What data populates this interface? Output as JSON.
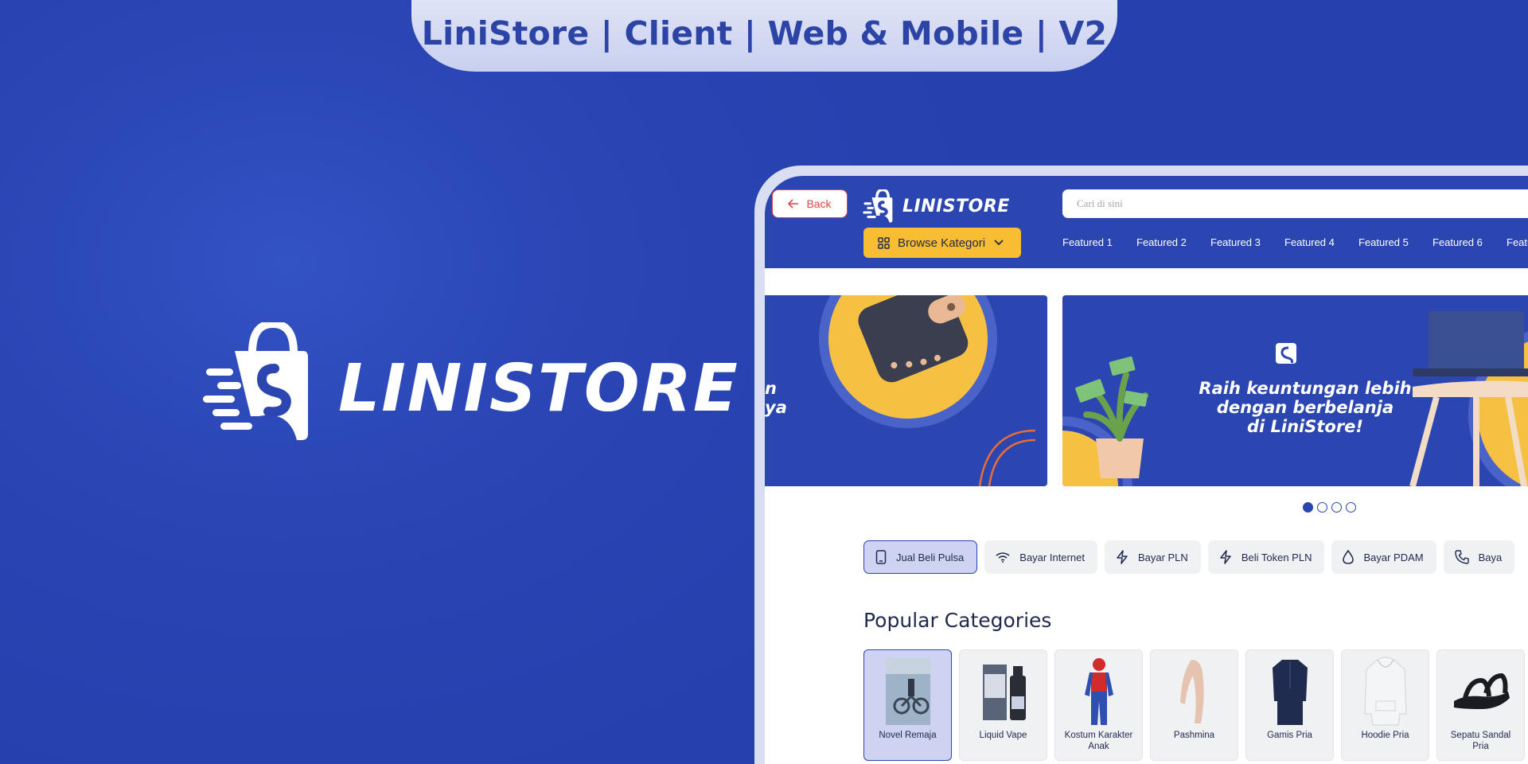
{
  "title_pill": "LiniStore | Client | Web & Mobile | V2",
  "brand": {
    "wordmark": "LINISTORE"
  },
  "site": {
    "back_label": "Back",
    "logo_wordmark": "LINISTORE",
    "search_placeholder": "Cari di sini",
    "browse_label": "Browse Kategori",
    "featured": [
      "Featured 1",
      "Featured 2",
      "Featured 3",
      "Featured 4",
      "Featured 5",
      "Featured 6",
      "Featu"
    ]
  },
  "banners": {
    "left_cut_text": [
      "n",
      "ya"
    ],
    "right_text": [
      "Raih keuntungan lebih",
      "dengan berbelanja",
      "di LiniStore!"
    ],
    "active_slide": 1,
    "slide_count": 4
  },
  "services": [
    {
      "label": "Jual Beli Pulsa",
      "icon": "phone-icon",
      "active": true
    },
    {
      "label": "Bayar Internet",
      "icon": "wifi-icon",
      "active": false
    },
    {
      "label": "Bayar PLN",
      "icon": "lightning-icon",
      "active": false
    },
    {
      "label": "Beli Token PLN",
      "icon": "lightning-icon",
      "active": false
    },
    {
      "label": "Bayar PDAM",
      "icon": "water-drop-icon",
      "active": false
    },
    {
      "label": "Baya",
      "icon": "telephone-icon",
      "active": false
    }
  ],
  "popular": {
    "title": "Popular Categories",
    "items": [
      {
        "name": "Novel Remaja",
        "active": true
      },
      {
        "name": "Liquid Vape",
        "active": false
      },
      {
        "name": "Kostum Karakter Anak",
        "active": false
      },
      {
        "name": "Pashmina",
        "active": false
      },
      {
        "name": "Gamis Pria",
        "active": false
      },
      {
        "name": "Hoodie Pria",
        "active": false
      },
      {
        "name": "Sepatu Sandal Pria",
        "active": false
      }
    ]
  },
  "colors": {
    "primary": "#2b46b0",
    "accent": "#f8bd33",
    "back_red": "#e04747",
    "text_dark": "#1f2a4e"
  }
}
